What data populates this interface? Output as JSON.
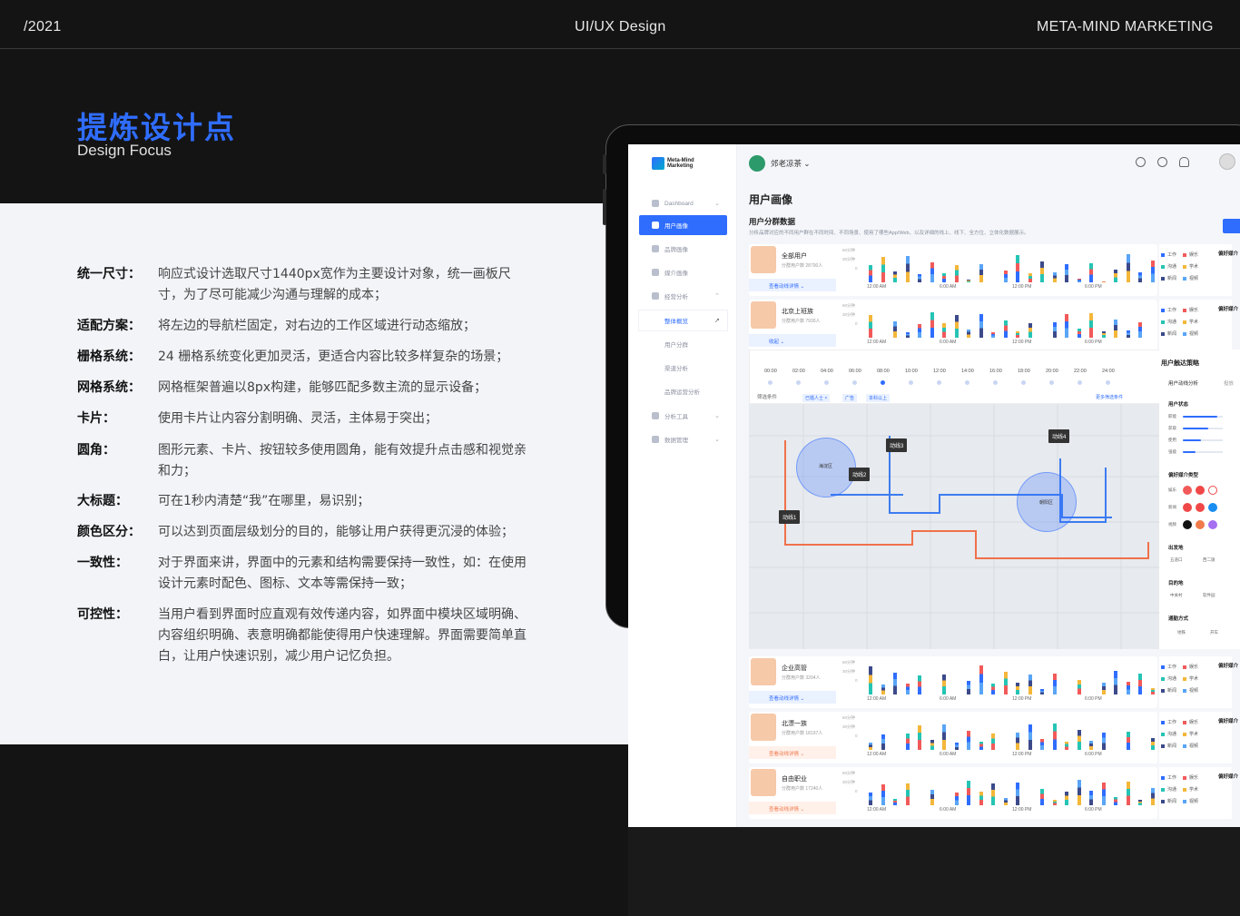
{
  "header": {
    "year": "/2021",
    "center": "UI/UX Design",
    "right": "META-MIND MARKETING"
  },
  "hero": {
    "title_zh": "提炼设计点",
    "title_en": "Design Focus"
  },
  "points": [
    {
      "k": "统一尺寸：",
      "v": "响应式设计选取尺寸1440px宽作为主要设计对象，统一画板尺寸，为了尽可能减少沟通与理解的成本；"
    },
    {
      "k": "适配方案：",
      "v": "将左边的导航栏固定，对右边的工作区域进行动态缩放；"
    },
    {
      "k": "栅格系统：",
      "v": "24 栅格系统变化更加灵活，更适合内容比较多样复杂的场景；"
    },
    {
      "k": "网格系统：",
      "v": "网格框架普遍以8px构建，能够匹配多数主流的显示设备；"
    },
    {
      "k": "卡片：",
      "v": "使用卡片让内容分割明确、灵活，主体易于突出；"
    },
    {
      "k": "圆角：",
      "v": "图形元素、卡片、按钮较多使用圆角，能有效提升点击感和视觉亲和力；"
    },
    {
      "k": "大标题：",
      "v": "可在1秒内清楚“我”在哪里，易识别；"
    },
    {
      "k": "颜色区分：",
      "v": "可以达到页面层级划分的目的，能够让用户获得更沉浸的体验；"
    },
    {
      "k": "一致性：",
      "v": "对于界面来讲，界面中的元素和结构需要保持一致性，如：在使用设计元素时配色、图标、文本等需保持一致；"
    },
    {
      "k": "可控性：",
      "v": "当用户看到界面时应直观有效传递内容，如界面中模块区域明确、内容组织明确、表意明确都能使得用户快速理解。界面需要简单直白，让用户快速识别，减少用户记忆负担。"
    }
  ],
  "app": {
    "logo": "Meta-Mind Marketing",
    "brand": "郊老凉茶",
    "nav": [
      {
        "label": "Dashboard",
        "icon": "dashboard-icon"
      },
      {
        "label": "用户画像",
        "icon": "user-icon",
        "active": true
      },
      {
        "label": "品牌画像",
        "icon": "heart-icon"
      },
      {
        "label": "媒介画像",
        "icon": "play-icon"
      },
      {
        "label": "经营分析",
        "icon": "monitor-icon"
      }
    ],
    "subnav": [
      "整体概览",
      "用户分群",
      "渠道分析",
      "品牌运营分析"
    ],
    "nav2": [
      {
        "label": "分析工具",
        "icon": "grid-icon"
      },
      {
        "label": "数据管理",
        "icon": "chart-icon"
      }
    ],
    "page_title": "用户画像",
    "section_title": "用户分群数据",
    "section_desc": "分析品牌对应的不同用户群在不同时间、不同场景、使用了哪些App/Web、以及详细的线上、线下、全方位、立体化数据展示。",
    "y_labels": [
      "60分钟",
      "30分钟",
      "0"
    ],
    "x_labels": [
      "12:00 AM",
      "6:00 AM",
      "12:00 PM",
      "6:00 PM"
    ],
    "legend": [
      "工作",
      "娱乐",
      "沟通",
      "学术",
      "新闻",
      "视频"
    ],
    "legend_colors": [
      "#2f6dff",
      "#f25a5a",
      "#25c4b4",
      "#f4b73a",
      "#3c4a8a",
      "#59a5f6"
    ],
    "fav_label": "偏好媒介",
    "cards": [
      {
        "name": "全部用户",
        "sub": "分群用户数 28790人",
        "detail": "查看动线详情",
        "style": "blue"
      },
      {
        "name": "北京上班族",
        "sub": "分群用户数 7930人",
        "detail": "收起",
        "style": "blue"
      },
      {
        "name": "企业高管",
        "sub": "分群用户数 3204人",
        "detail": "查看动线详情",
        "style": "blue"
      },
      {
        "name": "北漂一族",
        "sub": "分群用户数 18197人",
        "detail": "查看动线详情",
        "style": "orange"
      },
      {
        "name": "自由职业",
        "sub": "分群用户数 17240人",
        "detail": "查看动线详情",
        "style": "orange"
      }
    ],
    "timeline": [
      "00:00",
      "02:00",
      "04:00",
      "06:00",
      "08:00",
      "10:00",
      "12:00",
      "14:00",
      "16:00",
      "18:00",
      "20:00",
      "22:00",
      "24:00"
    ],
    "filter_label": "筛选条件",
    "chips": [
      "已婚人士 ×",
      "广告",
      "本科以上"
    ],
    "more_filters": "更多筛选条件",
    "map_labels": [
      "动线1",
      "动线2",
      "动线3",
      "动线4"
    ],
    "districts": [
      "海淀区",
      "朝阳区"
    ],
    "strategy": {
      "title": "用户触达策略",
      "tabs": [
        "用户动线分析",
        "投放"
      ],
      "status": "用户状态",
      "status_rows": [
        "职能",
        "获取",
        "使用",
        "强能"
      ],
      "media_type": "偏好媒介类型",
      "media_rows": [
        "娱乐",
        "新闻",
        "视频"
      ],
      "departure": "出发地",
      "departure_vals": [
        "五道口",
        "西二旗"
      ],
      "destination": "目的地",
      "destination_vals": [
        "中关村",
        "软件园"
      ],
      "commute": "通勤方式",
      "commute_vals": [
        "地铁",
        "开车"
      ]
    }
  }
}
